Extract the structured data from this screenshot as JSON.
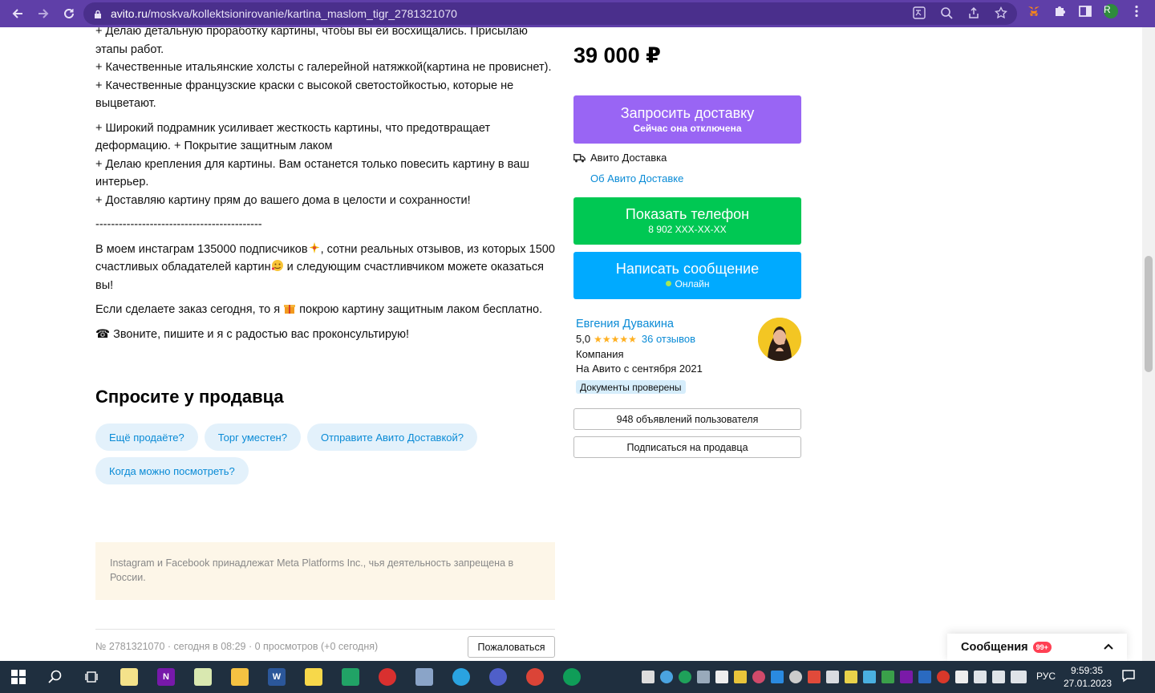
{
  "browser": {
    "url_host": "avito.ru",
    "url_path": "/moskva/kollektsionirovanie/kartina_maslom_tigr_2781321070",
    "profile_initial": "R"
  },
  "description": {
    "paragraphs": [
      "+ Делаю детальную проработку картины, чтобы вы ей восхищались. Присылаю этапы работ.",
      "+ Качественные итальянские холсты с галерейной натяжкой(картина не провиснет).",
      "+ Качественные французские краски с высокой светостойкостью, которые не выцветают.",
      "+ Широкий подрамник усиливает жесткость картины, что предотвращает деформацию. + Покрытие защитным лаком",
      "+ Делаю крепления для картины. Вам останется только повесить картину в ваш интерьер.",
      "+ Доставляю картину прям до вашего дома в целости и сохранности!",
      "-------------------------------------------",
      "В моем инстаграм 135000 подписчиков",
      ", сотни реальных отзывов, из которых 1500 счастливых обладателей картин",
      " и следующим счастливчиком можете оказаться вы!",
      "Если сделаете заказ сегодня, то я ",
      " покрою картину защитным лаком бесплатно.",
      "☎ Звоните, пишите и я с радостью вас проконсультирую!"
    ]
  },
  "ask_seller": {
    "title": "Спросите у продавца",
    "chips": [
      "Ещё продаёте?",
      "Торг уместен?",
      "Отправите Авито Доставкой?",
      "Когда можно посмотреть?"
    ]
  },
  "notice": "Instagram и Facebook принадлежат Meta Platforms Inc., чья деятельность запрещена в России.",
  "meta": {
    "text": "№ 2781321070 · сегодня в 08:29 · 0 просмотров (+0 сегодня)",
    "complain_label": "Пожаловаться"
  },
  "sidebar": {
    "price": "39 000 ₽",
    "delivery_button": {
      "main": "Запросить доставку",
      "sub": "Сейчас она отключена"
    },
    "delivery_label": "Авито Доставка",
    "delivery_link": "Об Авито Доставке",
    "phone_button": {
      "main": "Показать телефон",
      "sub": "8 902 XXX-XX-XX"
    },
    "message_button": {
      "main": "Написать сообщение",
      "sub": "Онлайн"
    },
    "seller": {
      "name": "Евгения Дувакина",
      "rating": "5,0",
      "stars": "★★★★★",
      "reviews": "36 отзывов",
      "type": "Компания",
      "since": "На Авито с сентября 2021",
      "verified": "Документы проверены"
    },
    "listings_button": "948 объявлений пользователя",
    "subscribe_button": "Подписаться на продавца"
  },
  "messages_panel": {
    "title": "Сообщения",
    "badge": "99+"
  },
  "taskbar": {
    "lang": "РУС",
    "time": "9:59:35",
    "date": "27.01.2023"
  },
  "colors": {
    "chrome": "#5f3fa8",
    "delivery": "#9965f4",
    "phone": "#00c853",
    "message": "#00aaff",
    "link": "#0a8bd6"
  }
}
